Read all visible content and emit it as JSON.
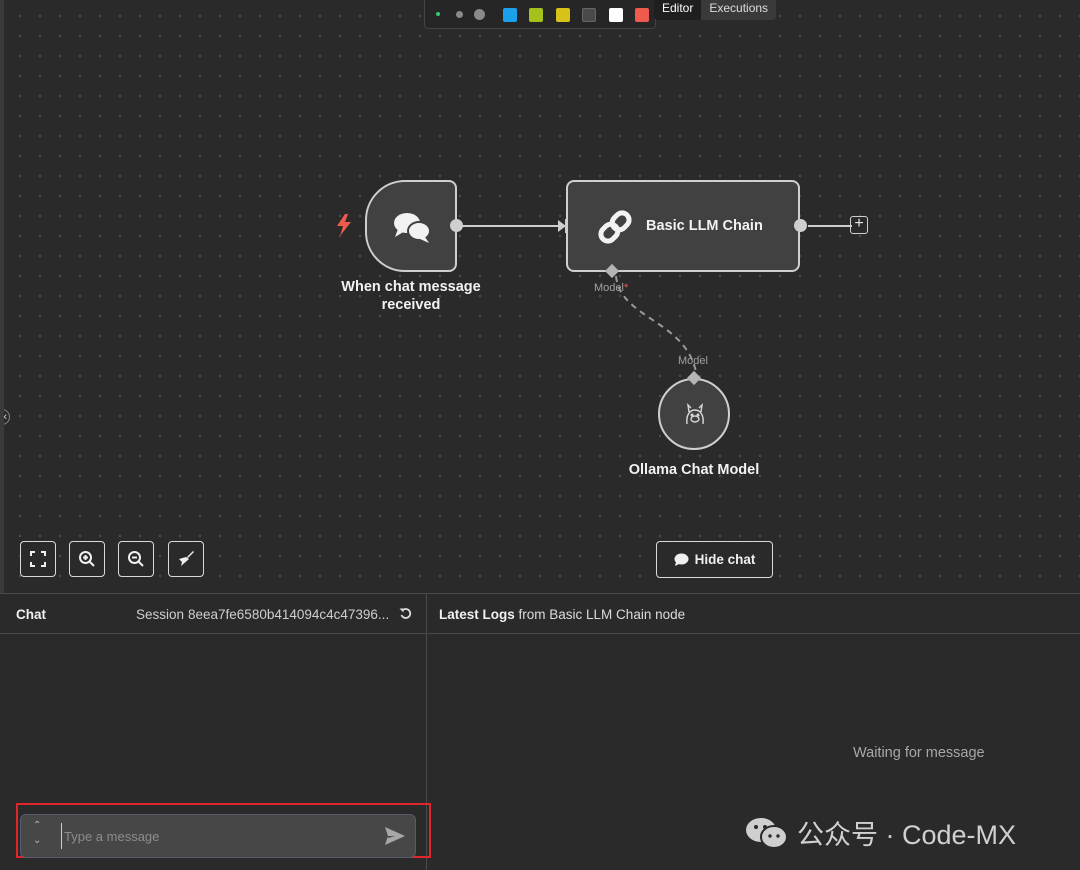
{
  "toolbar": {
    "swatches": [
      "#1ba1ec",
      "#a4c21b",
      "#d7c21a",
      "#4a4a4a",
      "#ffffff",
      "#ef5a4f"
    ]
  },
  "tabs": {
    "editor": "Editor",
    "executions": "Executions"
  },
  "nodes": {
    "trigger": {
      "label_line1": "When chat message",
      "label_line2": "received",
      "icon": "chat-bubbles-icon"
    },
    "chain": {
      "label": "Basic LLM Chain",
      "icon": "link-icon",
      "model_label": "Model",
      "required_mark": "*"
    },
    "model": {
      "label": "Ollama Chat Model",
      "port_label": "Model",
      "icon": "llama-icon"
    }
  },
  "controls": {
    "hide_chat": "Hide chat"
  },
  "chat": {
    "title": "Chat",
    "session_label": "Session",
    "session_id": "8eea7fe6580b414094c4c47396...",
    "input_placeholder": "Type a message"
  },
  "logs": {
    "title_bold": "Latest Logs",
    "title_rest": "from Basic LLM Chain node",
    "waiting": "Waiting for message"
  },
  "watermark": {
    "text": "公众号 · Code-MX"
  },
  "colors": {
    "accent_red": "#e0262b",
    "trigger_bolt": "#ef5a4f",
    "node_border": "#cfcfcf"
  }
}
